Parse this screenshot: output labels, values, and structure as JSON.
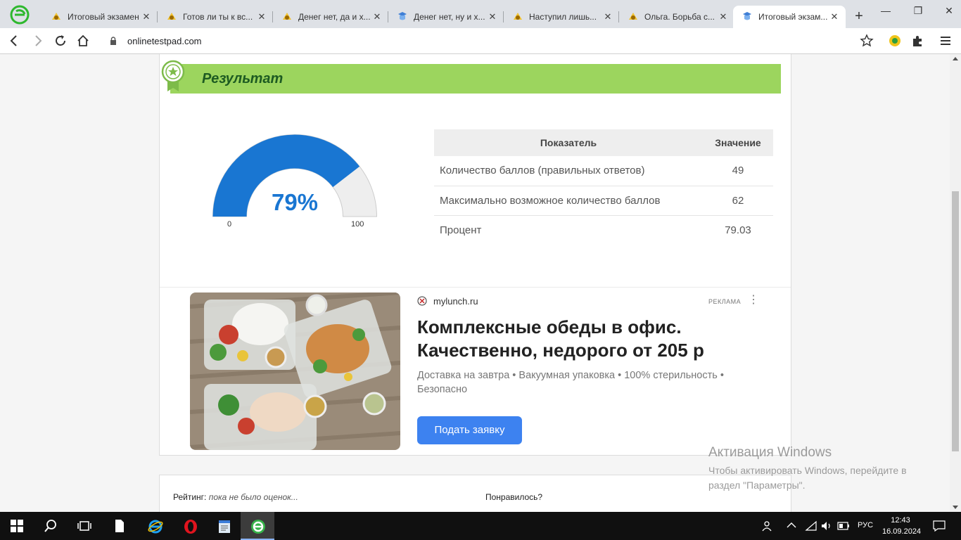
{
  "tabs": [
    {
      "title": "Итоговый экзамен",
      "icon": "school-badge-icon"
    },
    {
      "title": "Готов ли ты к вс...",
      "icon": "school-badge-icon"
    },
    {
      "title": "Денег нет, да и х...",
      "icon": "school-badge-icon"
    },
    {
      "title": "Денег нет, ну и х...",
      "icon": "quiz-badge-icon"
    },
    {
      "title": "Наступил лишь...",
      "icon": "school-badge-icon"
    },
    {
      "title": "Ольга. Борьба с...",
      "icon": "school-badge-icon"
    },
    {
      "title": "Итоговый экзам...",
      "icon": "quiz-badge-icon",
      "active": true
    }
  ],
  "toolbar": {
    "url": "onlinetestpad.com"
  },
  "result": {
    "title": "Результат",
    "gauge": {
      "percent_label": "79%",
      "percent": 79.03,
      "min_label": "0",
      "max_label": "100"
    },
    "table": {
      "headers": [
        "Показатель",
        "Значение"
      ],
      "rows": [
        {
          "label": "Количество баллов (правильных ответов)",
          "value": "49"
        },
        {
          "label": "Максимально возможное количество баллов",
          "value": "62"
        },
        {
          "label": "Процент",
          "value": "79.03"
        }
      ]
    }
  },
  "ad": {
    "domain": "mylunch.ru",
    "label": "РЕКЛАМА",
    "headline": "Комплексные обеды в офис. Качественно, недорого от 205 р",
    "text": "Доставка на завтра • Вакуумная упаковка • 100% стерильность • Безопасно",
    "cta": "Подать заявку"
  },
  "footer": {
    "rating_label": "Рейтинг:",
    "rating_value": "пока не было оценок...",
    "liked_label": "Понравилось?"
  },
  "activation": {
    "title": "Активация Windows",
    "text": "Чтобы активировать Windows, перейдите в раздел \"Параметры\"."
  },
  "taskbar": {
    "lang": "РУС",
    "time": "12:43",
    "date": "16.09.2024"
  },
  "colors": {
    "accent_green": "#9cd55e",
    "gauge_blue": "#1976d2",
    "cta_blue": "#3d82f0"
  }
}
